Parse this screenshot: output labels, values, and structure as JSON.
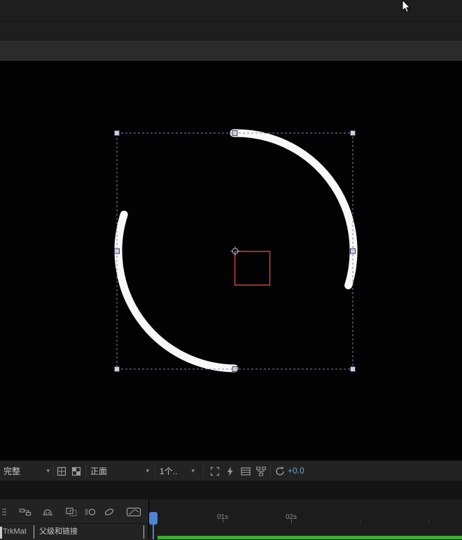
{
  "viewer_toolbar": {
    "magnification": "完整",
    "view_mode": "正面",
    "view_layout": "1个..",
    "exposure_value": "+0.0"
  },
  "timeline": {
    "ruler_labels": [
      {
        "text": "01s"
      },
      {
        "text": "02s"
      }
    ],
    "columns": {
      "trkmat": "TrkMat",
      "parent_link": "父级和链接"
    }
  },
  "glyphs": {
    "chevron_down": "▾"
  },
  "colors": {
    "playhead_blue": "#4d84d4",
    "render_bar_green": "#3fab31",
    "selection_outline": "#8080ac",
    "shape_path_red": "#b6423a",
    "arc_stroke": "#f7f7f7",
    "exposure_text_blue": "#6fa0d0"
  }
}
